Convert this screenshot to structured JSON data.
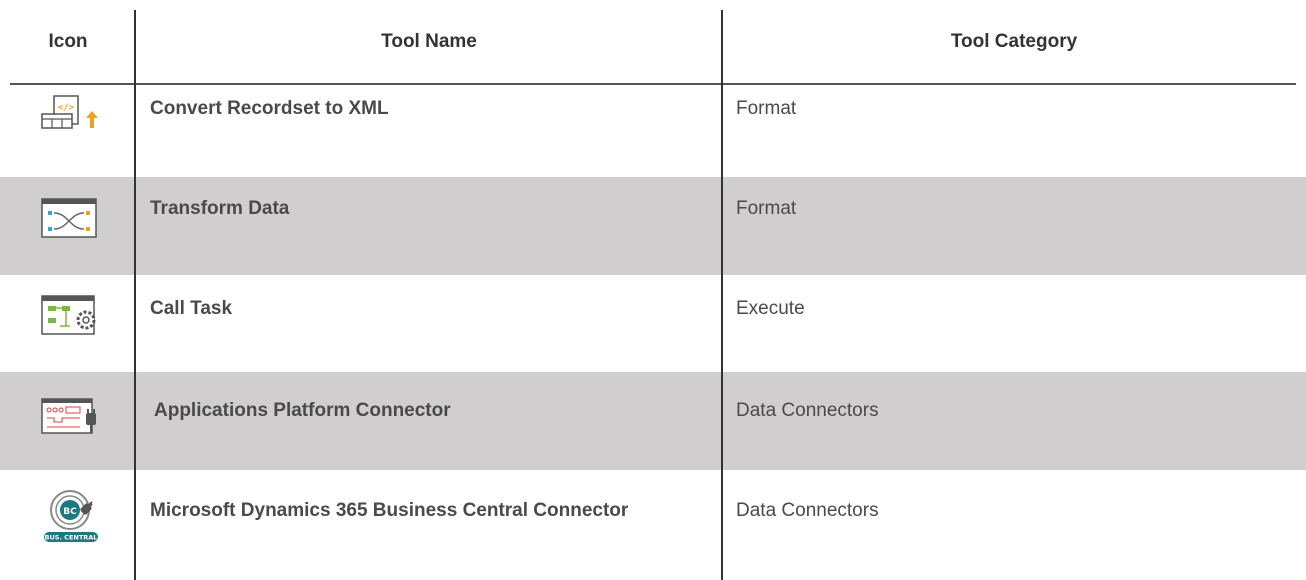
{
  "table": {
    "headers": {
      "icon": "Icon",
      "tool_name": "Tool Name",
      "tool_category": "Tool Category"
    },
    "rows": [
      {
        "icon": "convert-recordset-to-xml-icon",
        "tool_name": "Convert Recordset to XML",
        "tool_category": "Format",
        "shaded": false
      },
      {
        "icon": "transform-data-icon",
        "tool_name": "Transform Data",
        "tool_category": "Format",
        "shaded": true
      },
      {
        "icon": "call-task-icon",
        "tool_name": "Call Task",
        "tool_category": "Execute",
        "shaded": false
      },
      {
        "icon": "applications-platform-connector-icon",
        "tool_name": "Applications Platform Connector",
        "tool_category": "Data Connectors",
        "shaded": true
      },
      {
        "icon": "business-central-connector-icon",
        "tool_name": "Microsoft Dynamics 365 Business Central Connector",
        "tool_category": "Data Connectors",
        "shaded": false,
        "icon_text": {
          "badge": "BC",
          "label": "BUS. CENTRAL"
        }
      }
    ]
  },
  "colors": {
    "row_shade": "#d0cecf",
    "accent_orange": "#f0a020",
    "accent_green": "#7ab840",
    "accent_red": "#d84040",
    "accent_teal": "#1a7a80"
  }
}
